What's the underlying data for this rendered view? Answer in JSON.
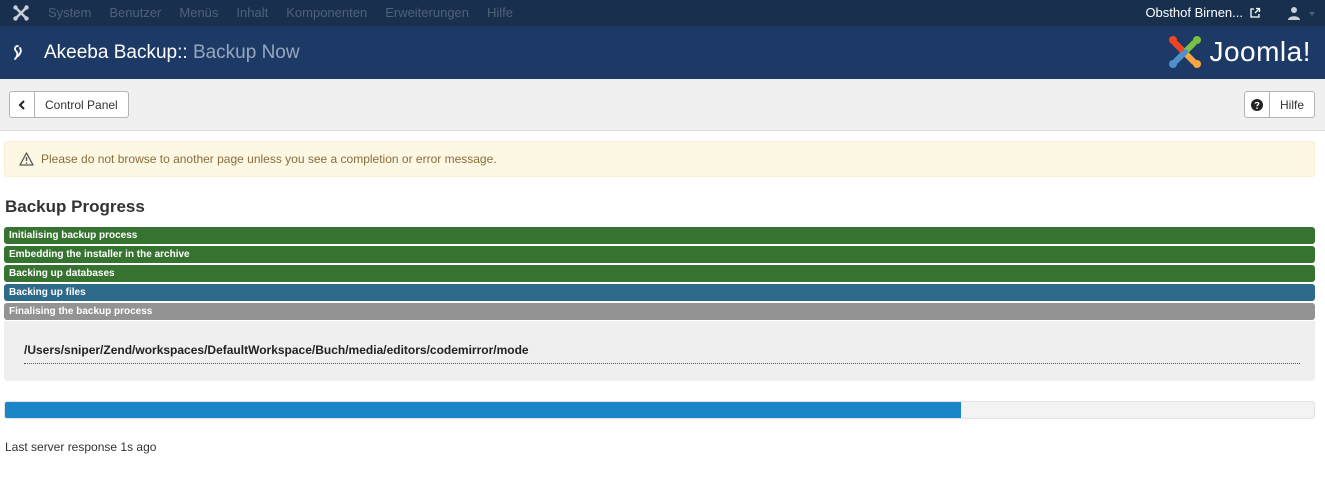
{
  "topnav": {
    "menu": [
      "System",
      "Benutzer",
      "Menüs",
      "Inhalt",
      "Komponenten",
      "Erweiterungen",
      "Hilfe"
    ],
    "site_name": "Obsthof Birnen..."
  },
  "header": {
    "title_main": "Akeeba Backup::",
    "title_sub": "Backup Now",
    "brand": "Joomla!"
  },
  "toolbar": {
    "back_label": "Control Panel",
    "help_label": "Hilfe"
  },
  "alert": {
    "message": "Please do not browse to another page unless you see a completion or error message."
  },
  "progress_section": {
    "title": "Backup Progress",
    "steps": [
      {
        "label": "Initialising backup process",
        "state": "done"
      },
      {
        "label": "Embedding the installer in the archive",
        "state": "done"
      },
      {
        "label": "Backing up databases",
        "state": "done"
      },
      {
        "label": "Backing up files",
        "state": "active"
      },
      {
        "label": "Finalising the backup process",
        "state": "pending"
      }
    ],
    "current_file": "/Users/sniper/Zend/workspaces/DefaultWorkspace/Buch/media/editors/codemirror/mode",
    "percent": 73,
    "server_response": "Last server response 1s ago"
  },
  "colors": {
    "done": "#377330",
    "active": "#2e6a89",
    "pending": "#939393",
    "progress_fill": "#1a86c8"
  }
}
